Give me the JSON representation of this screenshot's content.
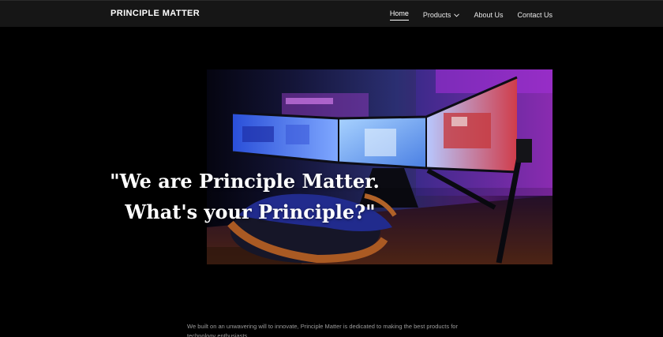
{
  "header": {
    "brand": "PRINCIPLE MATTER",
    "nav": [
      {
        "label": "Home",
        "active": true
      },
      {
        "label": "Products",
        "has_dropdown": true
      },
      {
        "label": "About Us"
      },
      {
        "label": "Contact Us"
      }
    ]
  },
  "hero": {
    "quote_line1": "\"We are Principle Matter.",
    "quote_line2": "What's your Principle?\""
  },
  "about": {
    "text": "We built on an unwavering will to innovate, Principle Matter is dedicated to making the best products for technology enthusiasts."
  },
  "colors": {
    "background": "#000000",
    "navbar": "#161616",
    "text_primary": "#ffffff",
    "text_muted": "#9c9c9c"
  },
  "icons": {
    "products_dropdown": "chevron-down-icon"
  }
}
